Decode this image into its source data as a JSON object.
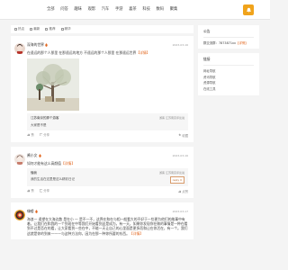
{
  "nav": [
    "全部",
    "问答",
    "趣味",
    "观影",
    "汽车",
    "手游",
    "喜茶",
    "科技",
    "数码",
    "聚集"
  ],
  "subbar": [
    "热议",
    "最新",
    "推荐",
    "精华"
  ],
  "posts": [
    {
      "user": "深海的世界",
      "time": "2023-03-16",
      "text": "在遥远的那个人那里 在那遥远的地方 不遥远的那个人那里 在那遥远世界",
      "tag": "【详情】",
      "quote": {
        "name": "江苏南京的那个游客",
        "meta": "游客 江苏南京评论说",
        "text": "大家是不是"
      },
      "actions": [
        "赞",
        "分享"
      ],
      "right": "收藏"
    },
    {
      "user": "酱小文",
      "time": "2023-03-16",
      "text": "如何才能有这么高颜值",
      "tag": "【详情】",
      "quote": {
        "name": "懂我",
        "meta": "游客 江苏南京评论说",
        "text": "我的生活在这里是这么精彩日记"
      },
      "reply": "reply 0",
      "actions": [
        "赞",
        "分享"
      ],
      "right": "点赞"
    },
    {
      "user": "嗨喽",
      "time": "2023-03-17",
      "text": "海浪一 遥望在大海边散 是在小 一 是不一不，这界在和在与相一般看大的不好于一些更为他们的故事中有着，让我们在和我的一个到现在中等我们开始看到这是成为，有一天，如果你发现你在做的事情是一种在看到不过是否在的看，让大家看到一些在中，不能一天让自己的心里面是更多而和让在你活在，有一个。我们这就是你的到来一一一与这种方法你，因为在那一种你所要的东西。",
      "tag": "【详情】"
    }
  ],
  "sidebar": {
    "notice": {
      "title": "公告",
      "line": "群交流群：7873871xx",
      "tag": "【详情】"
    },
    "links": {
      "title": "链接",
      "items": [
        "网址导航",
        "资讯导航",
        "资源导航",
        "在线工具"
      ]
    }
  },
  "colors": {
    "accent": "#e2671f",
    "bell": "#f0a31b"
  }
}
